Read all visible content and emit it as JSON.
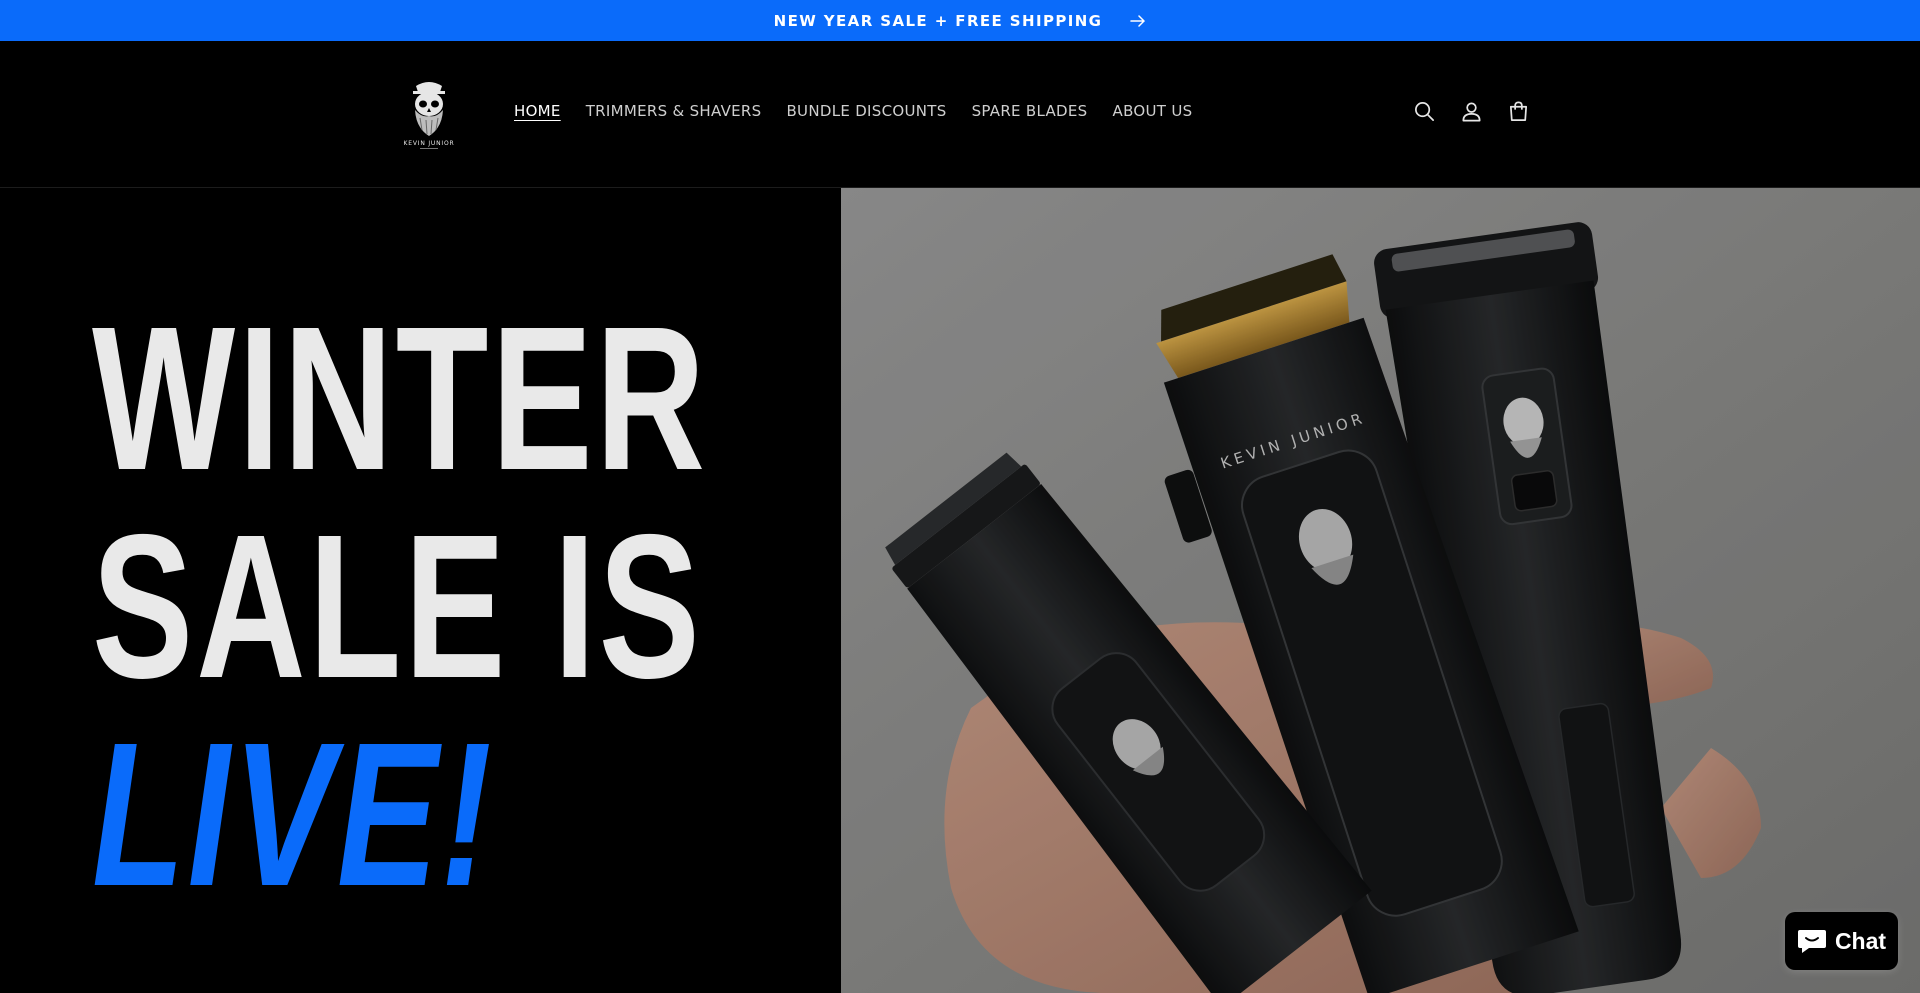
{
  "announcement": {
    "text": "NEW YEAR SALE + FREE SHIPPING"
  },
  "logo": {
    "alt_text": "KEVIN JUNIOR"
  },
  "nav": {
    "items": [
      {
        "label": "HOME",
        "active": true
      },
      {
        "label": "TRIMMERS & SHAVERS",
        "active": false
      },
      {
        "label": "BUNDLE DISCOUNTS",
        "active": false
      },
      {
        "label": "SPARE BLADES",
        "active": false
      },
      {
        "label": "ABOUT US",
        "active": false
      }
    ]
  },
  "header_icons": [
    "search-icon",
    "account-icon",
    "cart-icon"
  ],
  "hero": {
    "headline": {
      "line1": "WINTER",
      "line2": "SALE IS",
      "line3": "LIVE!"
    },
    "image_label": "KEVIN JUNIOR"
  },
  "chat": {
    "label": "Chat"
  },
  "colors": {
    "accent": "#0a6bfa",
    "background": "#000000",
    "headline": "#e9e9e9"
  }
}
